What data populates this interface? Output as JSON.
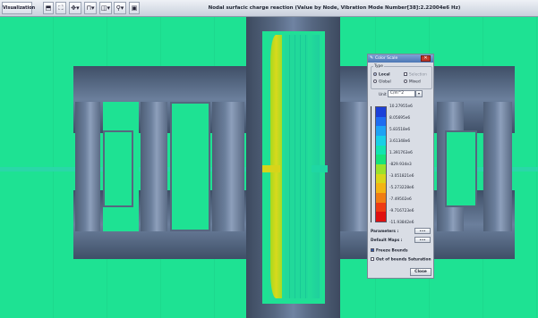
{
  "toolbar": {
    "visualization_label": "Visualization",
    "title": "Nodal surfacic charge reaction (Value by Node, Vibration Mode Number[38]:2.22004e6 Hz)",
    "icons": [
      "model-view-icon",
      "fit-view-icon",
      "rotate-icon",
      "translate-icon",
      "zoom-icon",
      "filter-icon",
      "screenshot-icon"
    ]
  },
  "dialog": {
    "title": "Color Scale",
    "type_label": "Type",
    "local_label": "Local",
    "selection_label": "Selection",
    "global_label": "Global",
    "mixed_label": "Mixed",
    "unit_label": "Unit",
    "unit_value": "C/m^2",
    "parameters_label": "Parameters :",
    "default_maps_label": "Default Maps :",
    "more_button": "•••",
    "freeze_bounds_label": "Freeze Bounds",
    "out_of_bounds_label": "Out of bounds Saturation",
    "close_button": "Close",
    "scale_labels": [
      "10.27955e6",
      "8.05695e6",
      "5.83518e6",
      "3.61348e6",
      "1.391763e6",
      "-829.934e3",
      "-3.051821e6",
      "-5.273228e6",
      "-7.49502e6",
      "-9.716723e6",
      "-11.93842e6"
    ],
    "scale_colors": [
      "#1b3fd8",
      "#1e6cf0",
      "#1ea2f4",
      "#19cfe6",
      "#13e3b0",
      "#17e27a",
      "#9be12c",
      "#d9d51b",
      "#f2b415",
      "#f07d14",
      "#ee3b13",
      "#e01010"
    ]
  }
}
